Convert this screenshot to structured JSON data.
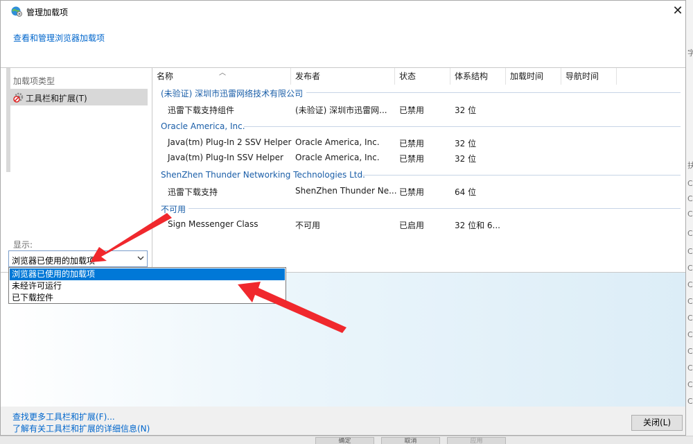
{
  "window": {
    "title": "管理加载项",
    "close_glyph": "✕"
  },
  "header": {
    "link": "查看和管理浏览器加载项"
  },
  "left": {
    "type_label": "加载项类型",
    "type_item": "工具栏和扩展(T)",
    "show_label": "显示:",
    "select_value": "浏览器已使用的加载项",
    "options": [
      "浏览器已使用的加载项",
      "未经许可运行",
      "已下载控件"
    ]
  },
  "columns": [
    "名称",
    "发布者",
    "状态",
    "体系结构",
    "加载时间",
    "导航时间"
  ],
  "groups": [
    {
      "name": "(未验证) 深圳市迅雷网络技术有限公司",
      "rows": [
        {
          "name": "迅雷下载支持组件",
          "publisher": "(未验证) 深圳市迅雷网...",
          "status": "已禁用",
          "arch": "32 位"
        }
      ]
    },
    {
      "name": "Oracle America, Inc.",
      "rows": [
        {
          "name": "Java(tm) Plug-In 2 SSV Helper",
          "publisher": "Oracle America, Inc.",
          "status": "已禁用",
          "arch": "32 位"
        },
        {
          "name": "Java(tm) Plug-In SSV Helper",
          "publisher": "Oracle America, Inc.",
          "status": "已禁用",
          "arch": "32 位"
        }
      ]
    },
    {
      "name": "ShenZhen Thunder Networking Technologies Ltd.",
      "rows": [
        {
          "name": "迅雷下载支持",
          "publisher": "ShenZhen Thunder Ne...",
          "status": "已禁用",
          "arch": "64 位"
        }
      ]
    },
    {
      "name": "不可用",
      "rows": [
        {
          "name": "Sign Messenger Class",
          "publisher": "不可用",
          "status": "已启用",
          "arch": "32 位和 6..."
        }
      ]
    }
  ],
  "footer": {
    "link1": "查找更多工具栏和扩展(F)...",
    "link2": "了解有关工具栏和扩展的详细信息(N)",
    "close_button": "关闭(L)"
  },
  "background": {
    "right_glyphs": [
      "字",
      "扶",
      "C",
      "C",
      "C",
      "C",
      "C",
      "C",
      "C",
      "C",
      "C",
      "C",
      "C",
      "C",
      "C",
      "C"
    ],
    "bottom_buttons": [
      "确定",
      "取消",
      "应用"
    ]
  },
  "colors": {
    "link": "#0066cc",
    "group": "#1a5ea8",
    "selection": "#0078d7",
    "arrow": "#f0282d"
  }
}
